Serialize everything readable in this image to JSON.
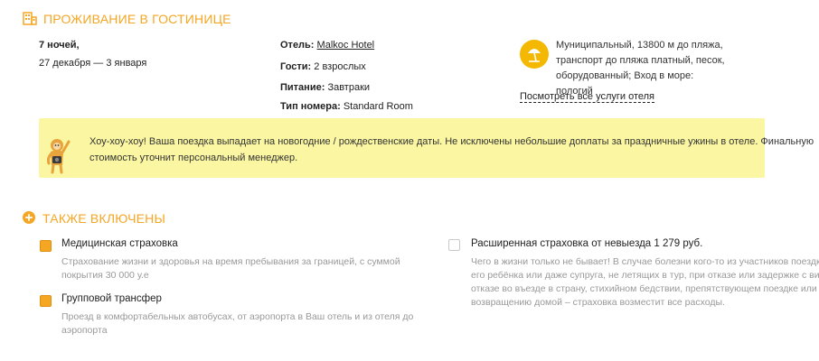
{
  "hotel_section": {
    "title": "ПРОЖИВАНИЕ В ГОСТИНИЦЕ",
    "nights": "7 ночей,",
    "dates": "27 декабря — 3 января",
    "hotel_label": "Отель:",
    "hotel_name": "Malkoc Hotel",
    "guests_label": "Гости:",
    "guests_value": "2 взрослых",
    "meals_label": "Питание:",
    "meals_value": "Завтраки",
    "room_label": "Тип номера:",
    "room_value": "Standard Room",
    "beach_line1": "Муниципальный, 13800 м до пляжа,",
    "beach_line2": "транспорт до пляжа платный, песок,",
    "beach_line3": "оборудованный; Вход в море: пологий",
    "services_link": "Посмотреть все услуги отеля",
    "notice_line1": "Хоу-хоу-хоу! Ваша поездка выпадает на новогодние / рождественские даты. Не исключены небольшие доплаты за праздничные ужины в отеле. Финальную",
    "notice_line2": "стоимость уточнит персональный менеджер."
  },
  "included_section": {
    "title": "ТАКЖЕ ВКЛЮЧЕНЫ",
    "items": [
      {
        "title": "Медицинская страховка",
        "checked": true,
        "desc_line1": "Страхование жизни и здоровья на время пребывания за границей, с суммой",
        "desc_line2": "покрытия 30 000 у.е"
      },
      {
        "title": "Групповой трансфер",
        "checked": true,
        "desc_line1": "Проезд в комфортабельных автобусах, от аэропорта в Ваш отель и из отеля до",
        "desc_line2": "аэропорта"
      },
      {
        "title": "Расширенная страховка от невыезда 1 279 руб.",
        "checked": false,
        "desc_line1": "Чего в жизни только не бывает! В случае болезни кого-то из участников поездки,",
        "desc_line2": "его ребёнка или даже супруга, не летящих в тур, при отказе или задержке с визой,",
        "desc_line3": "отказе во въезде в страну, стихийном бедствии, препятствующем поездке или",
        "desc_line4": "возвращению домой – страховка возместит все расходы."
      }
    ]
  },
  "colors": {
    "accent": "#f5a623",
    "notice_bg": "#fbf6a2",
    "muted_text": "#999999"
  }
}
